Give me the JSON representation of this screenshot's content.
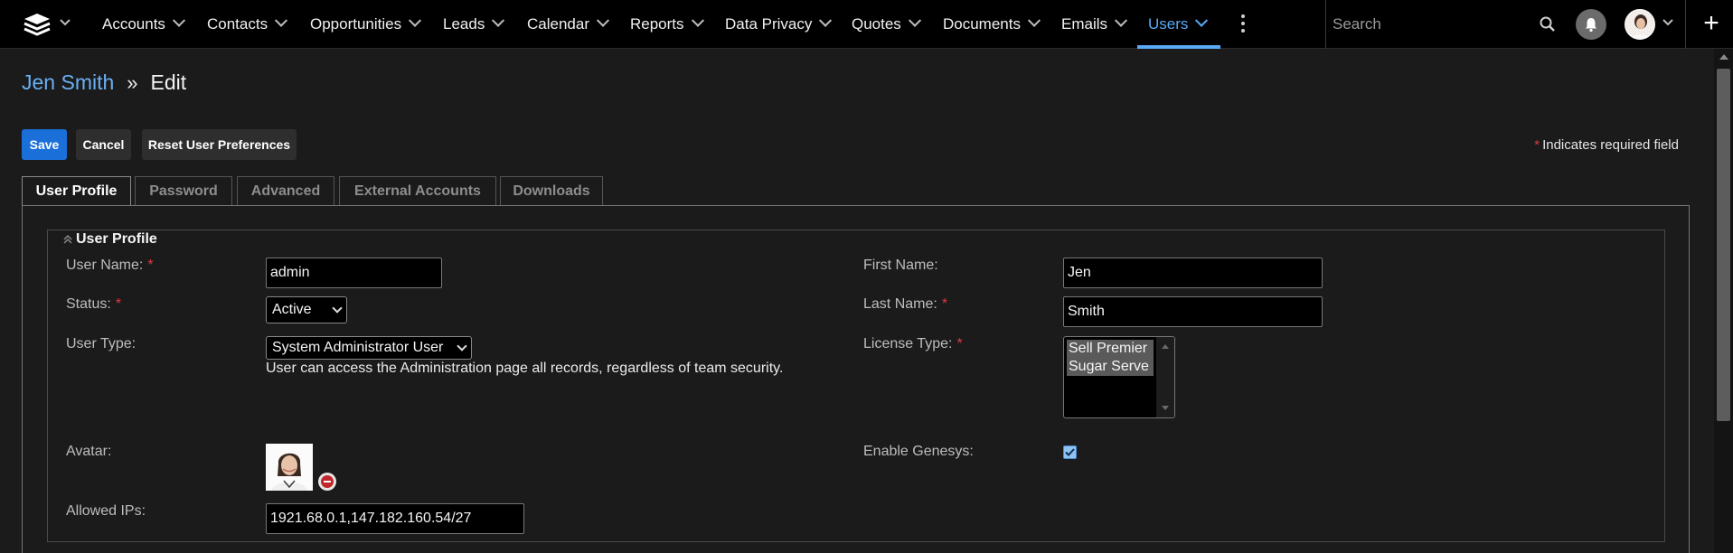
{
  "nav": {
    "logo_icon": "stack-layers-icon",
    "items": [
      {
        "label": "Accounts"
      },
      {
        "label": "Contacts"
      },
      {
        "label": "Opportunities"
      },
      {
        "label": "Leads"
      },
      {
        "label": "Calendar"
      },
      {
        "label": "Reports"
      },
      {
        "label": "Data Privacy"
      },
      {
        "label": "Quotes"
      },
      {
        "label": "Documents"
      },
      {
        "label": "Emails"
      },
      {
        "label": "Users",
        "active": true
      }
    ],
    "more_icon": "vertical-dots-icon",
    "search_placeholder": "Search",
    "search_icon": "search-icon",
    "notifications_icon": "bell-icon",
    "plus_label": "+",
    "accent_color": "#59a9f5"
  },
  "breadcrumb": {
    "record_name": "Jen Smith",
    "separator": "»",
    "action": "Edit"
  },
  "toolbar": {
    "save_label": "Save",
    "cancel_label": "Cancel",
    "reset_label": "Reset User Preferences",
    "primary_color": "#1a6fd9"
  },
  "required_note": {
    "star": "*",
    "text": "Indicates required field"
  },
  "tabs": [
    {
      "label": "User Profile",
      "active": true
    },
    {
      "label": "Password"
    },
    {
      "label": "Advanced"
    },
    {
      "label": "External Accounts"
    },
    {
      "label": "Downloads"
    }
  ],
  "section": {
    "title": "User Profile",
    "fields": {
      "user_name": {
        "label": "User Name:",
        "required": "*",
        "value": "admin"
      },
      "status": {
        "label": "Status:",
        "required": "*",
        "value": "Active"
      },
      "user_type": {
        "label": "User Type:",
        "value": "System Administrator User",
        "help": "User can access the Administration page all records, regardless of team security."
      },
      "avatar": {
        "label": "Avatar:"
      },
      "allowed_ips": {
        "label": "Allowed IPs:",
        "value": "1921.68.0.1,147.182.160.54/27"
      },
      "first_name": {
        "label": "First Name:",
        "value": "Jen"
      },
      "last_name": {
        "label": "Last Name:",
        "required": "*",
        "value": "Smith"
      },
      "license_type": {
        "label": "License Type:",
        "required": "*",
        "options": [
          "Sell Premier",
          "Sugar Serve"
        ]
      },
      "enable_genesys": {
        "label": "Enable Genesys:",
        "checked": true
      }
    }
  },
  "required_color": "#e0393e"
}
